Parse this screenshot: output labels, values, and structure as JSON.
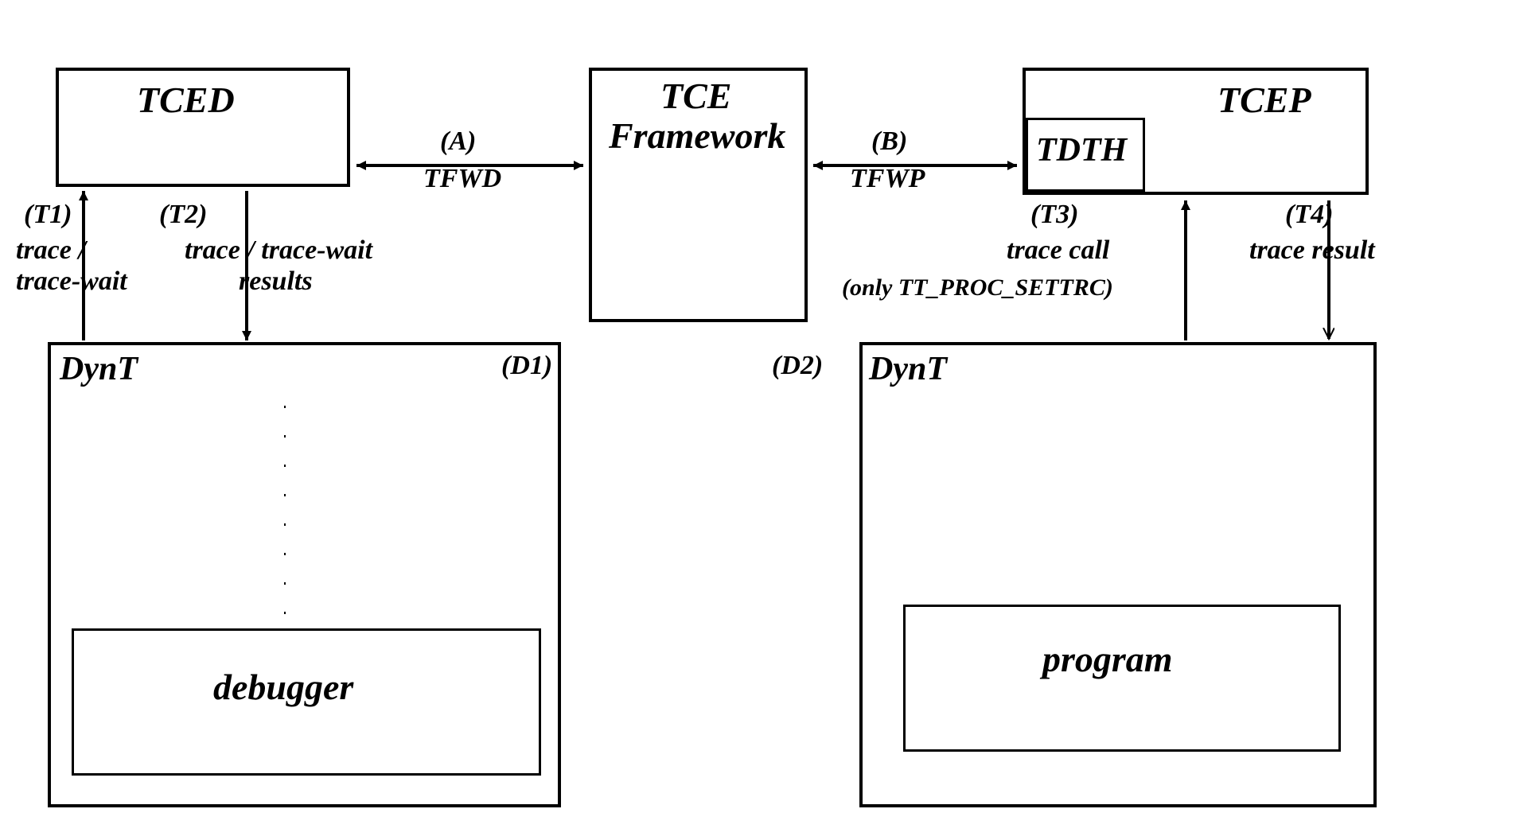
{
  "boxes": {
    "tced": "TCED",
    "tce_framework_line1": "TCE",
    "tce_framework_line2": "Framework",
    "tcep": "TCEP",
    "tdth": "TDTH",
    "dynt_left": "DynT",
    "dynt_right": "DynT",
    "debugger": "debugger",
    "program": "program"
  },
  "arrows": {
    "a_tag": "(A)",
    "a_label": "TFWD",
    "b_tag": "(B)",
    "b_label": "TFWP",
    "t1_tag": "(T1)",
    "t1_label": "trace /\ntrace-wait",
    "t2_tag": "(T2)",
    "t2_label": "trace / trace-wait\n        results",
    "t3_tag": "(T3)",
    "t3_label": "trace call",
    "t3_note": "(only TT_PROC_SETTRC)",
    "t4_tag": "(T4)",
    "t4_label": "trace result",
    "d1": "(D1)",
    "d2": "(D2)"
  }
}
